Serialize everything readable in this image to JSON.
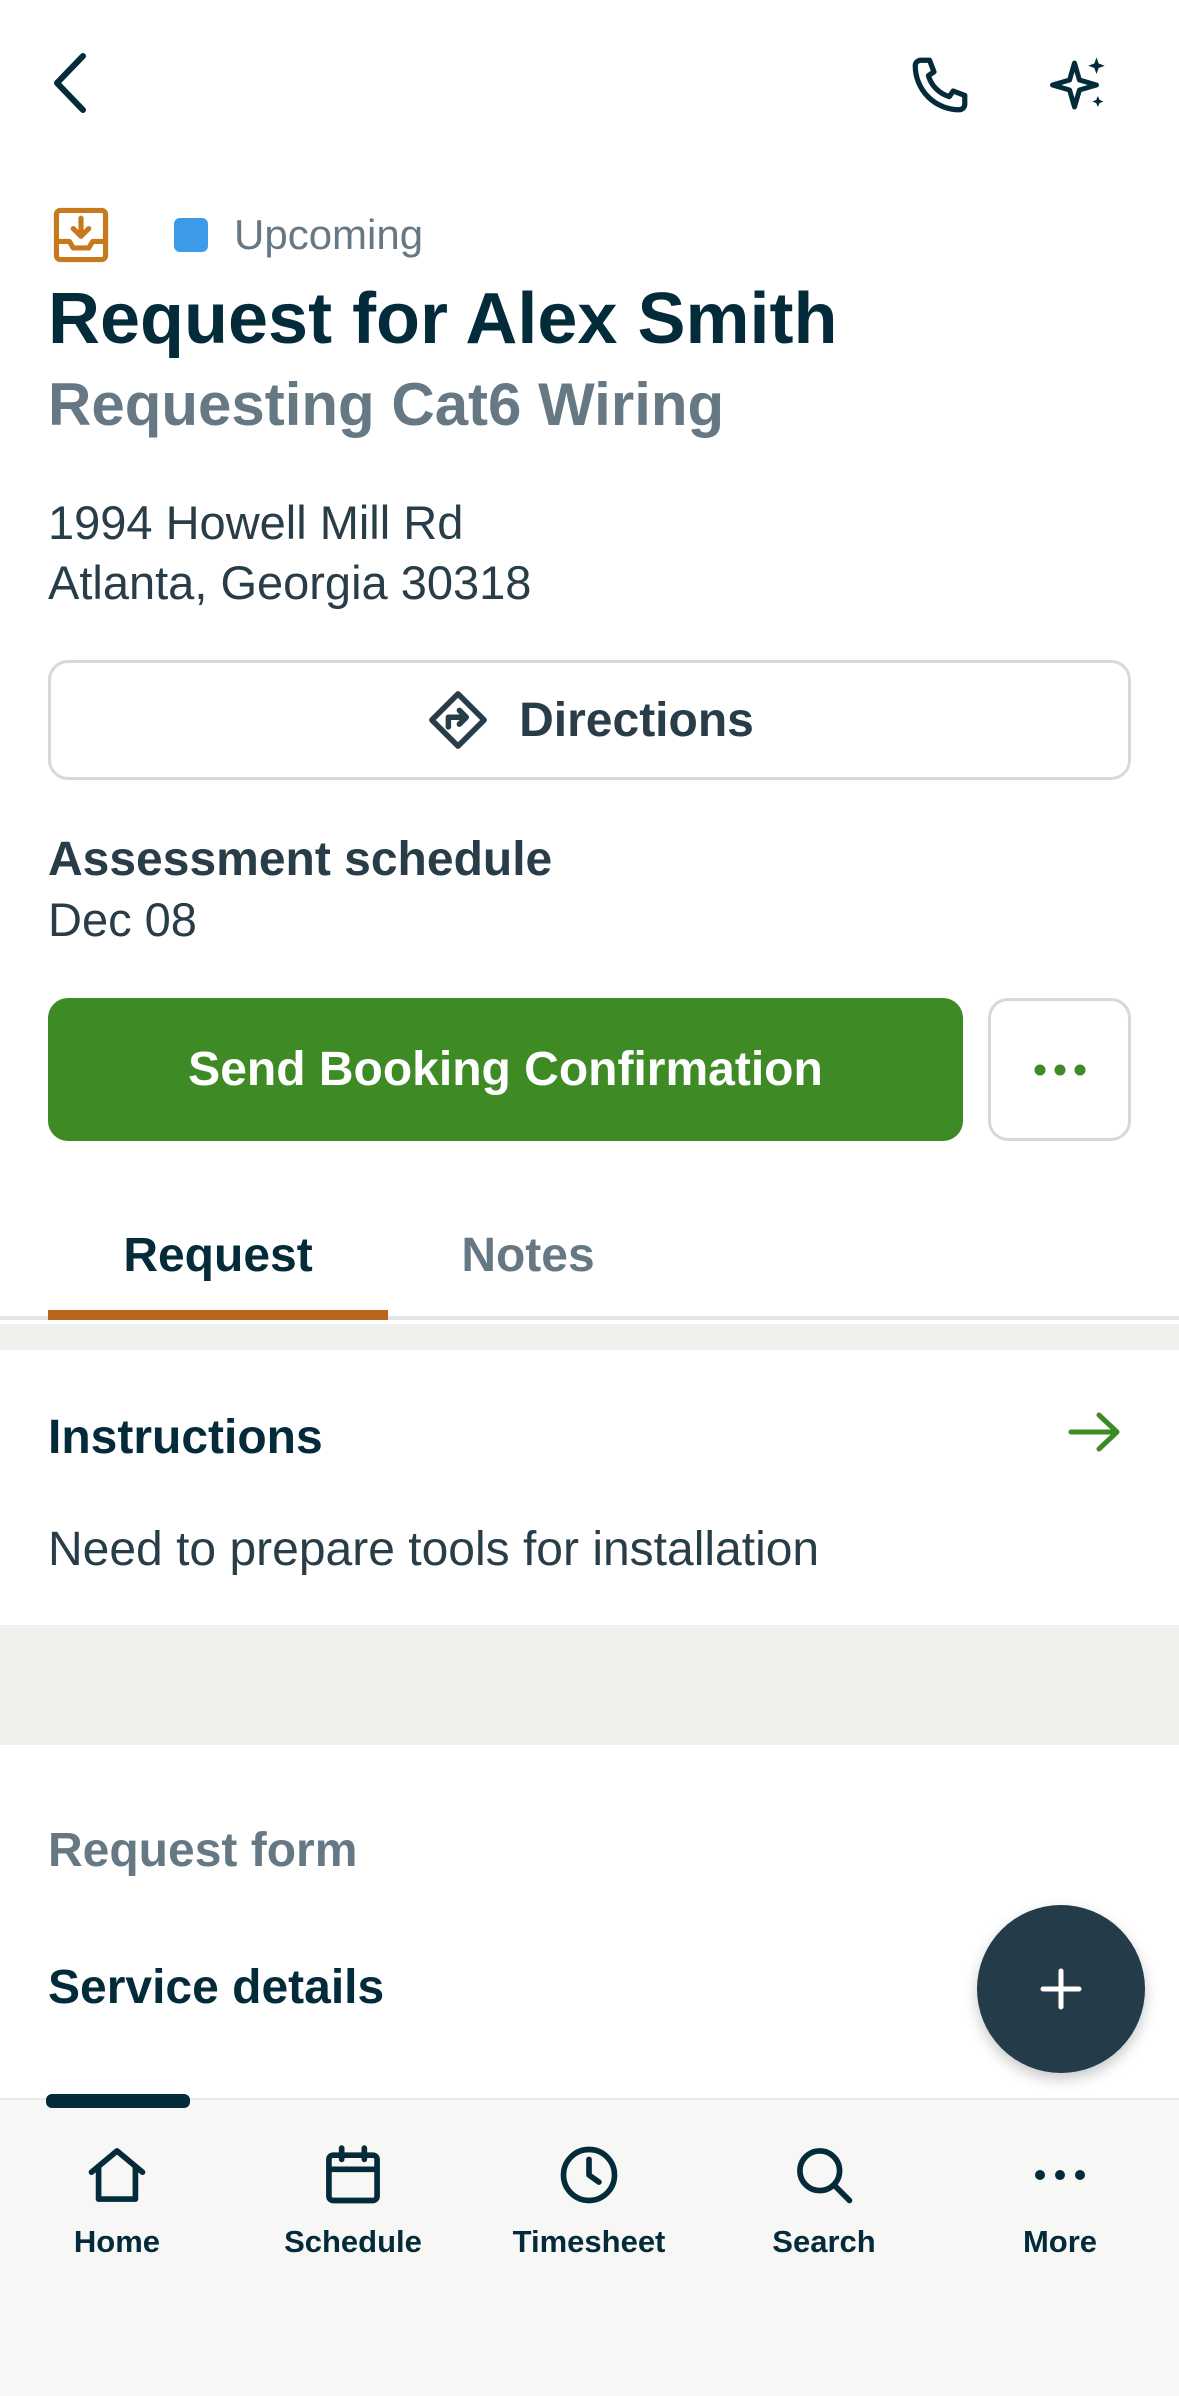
{
  "header": {
    "back_icon": "chevron-left-icon",
    "call_icon": "phone-icon",
    "ai_icon": "sparkles-icon"
  },
  "status": {
    "icon": "inbox-download-icon",
    "label": "Upcoming",
    "color": "#3d9ae8"
  },
  "request": {
    "title": "Request for Alex Smith",
    "subtitle": "Requesting Cat6 Wiring",
    "address_line1": "1994 Howell Mill Rd",
    "address_line2": "Atlanta, Georgia 30318"
  },
  "directions": {
    "label": "Directions",
    "icon": "directions-icon"
  },
  "assessment": {
    "label": "Assessment schedule",
    "date": "Dec 08"
  },
  "actions": {
    "primary_label": "Send Booking Confirmation",
    "primary_color": "#3e8a25",
    "more_icon": "ellipsis-icon"
  },
  "tabs": [
    {
      "label": "Request",
      "active": true
    },
    {
      "label": "Notes",
      "active": false
    }
  ],
  "instructions": {
    "title": "Instructions",
    "text": "Need to prepare tools for installation"
  },
  "request_form": {
    "label": "Request form",
    "section_title": "Service details"
  },
  "fab": {
    "icon": "plus-icon"
  },
  "bottom_nav": [
    {
      "label": "Home",
      "icon": "home-icon",
      "active": true
    },
    {
      "label": "Schedule",
      "icon": "calendar-icon",
      "active": false
    },
    {
      "label": "Timesheet",
      "icon": "clock-icon",
      "active": false
    },
    {
      "label": "Search",
      "icon": "search-icon",
      "active": false
    },
    {
      "label": "More",
      "icon": "ellipsis-icon",
      "active": false
    }
  ],
  "colors": {
    "primary_text": "#032b3a",
    "secondary_text": "#657884",
    "tab_accent": "#b9651b",
    "status_icon": "#c77a1d"
  }
}
